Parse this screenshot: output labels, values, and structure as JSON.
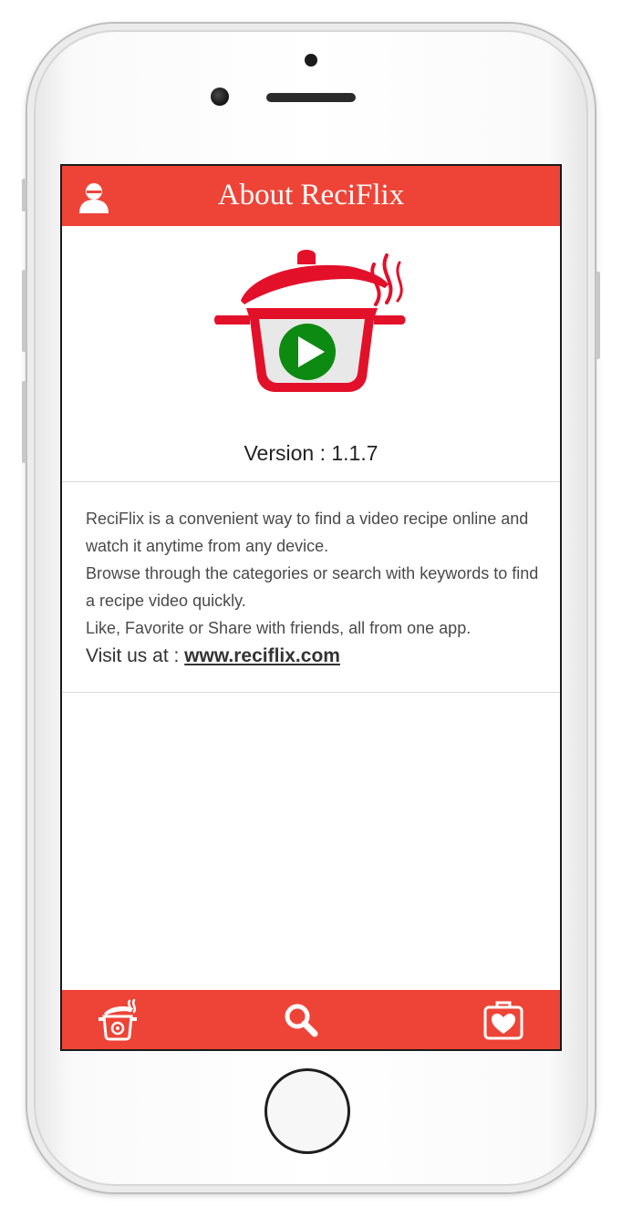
{
  "header": {
    "title": "About ReciFlix"
  },
  "app": {
    "version_text": "Version : 1.1.7"
  },
  "description": {
    "paragraph_1": "ReciFlix is a convenient way to find a video recipe online and watch it anytime from any device.",
    "paragraph_2": "Browse through the categories or search with keywords to find a recipe video quickly.",
    "paragraph_3": "Like, Favorite or Share with friends, all from one app.",
    "visit_label": "Visit us at : ",
    "visit_link": "www.reciflix.com"
  },
  "icons": {
    "profile": "user-icon",
    "logo": "cooking-pot-play-icon",
    "home": "pot-icon",
    "search": "search-icon",
    "favorites": "heart-box-icon"
  },
  "colors": {
    "accent": "#ee4437",
    "play_green": "#0d8a12"
  }
}
